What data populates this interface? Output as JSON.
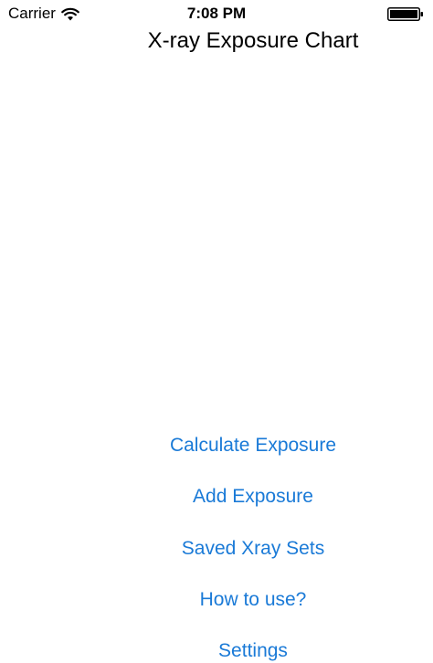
{
  "status_bar": {
    "carrier": "Carrier",
    "time": "7:08 PM",
    "wifi_icon": "wifi-icon",
    "battery_icon": "battery-icon"
  },
  "title": "X-ray Exposure Chart",
  "menu": {
    "accent_color": "#1a7ad7",
    "items": [
      {
        "label": "Calculate Exposure"
      },
      {
        "label": "Add Exposure"
      },
      {
        "label": "Saved Xray Sets"
      },
      {
        "label": "How to use?"
      },
      {
        "label": "Settings"
      }
    ]
  }
}
